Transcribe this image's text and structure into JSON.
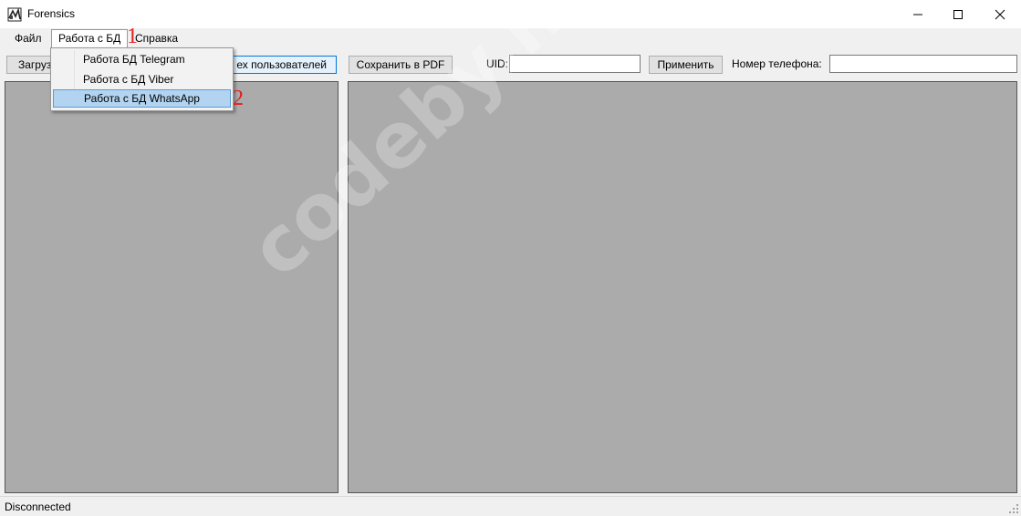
{
  "window": {
    "title": "Forensics"
  },
  "menu": {
    "file": "Файл",
    "db": "Работа с БД",
    "help": "Справка",
    "db_items": [
      "Работа  БД Telegram",
      "Работа с БД Viber",
      "Работа с БД WhatsApp"
    ]
  },
  "toolbar": {
    "load_label": "Загруз",
    "users_label": "ех пользователей",
    "pdf_label": "Сохранить в PDF",
    "uid_label": "UID:",
    "uid_value": "",
    "apply_label": "Применить",
    "phone_label": "Номер телефона:",
    "phone_value": ""
  },
  "annotations": {
    "one": "1",
    "two": "2"
  },
  "watermark": "codeby.net",
  "status": {
    "text": "Disconnected"
  },
  "colors": {
    "panel_bg": "#ababab",
    "highlight": "#b2d4f0",
    "annotation": "#e02020"
  }
}
